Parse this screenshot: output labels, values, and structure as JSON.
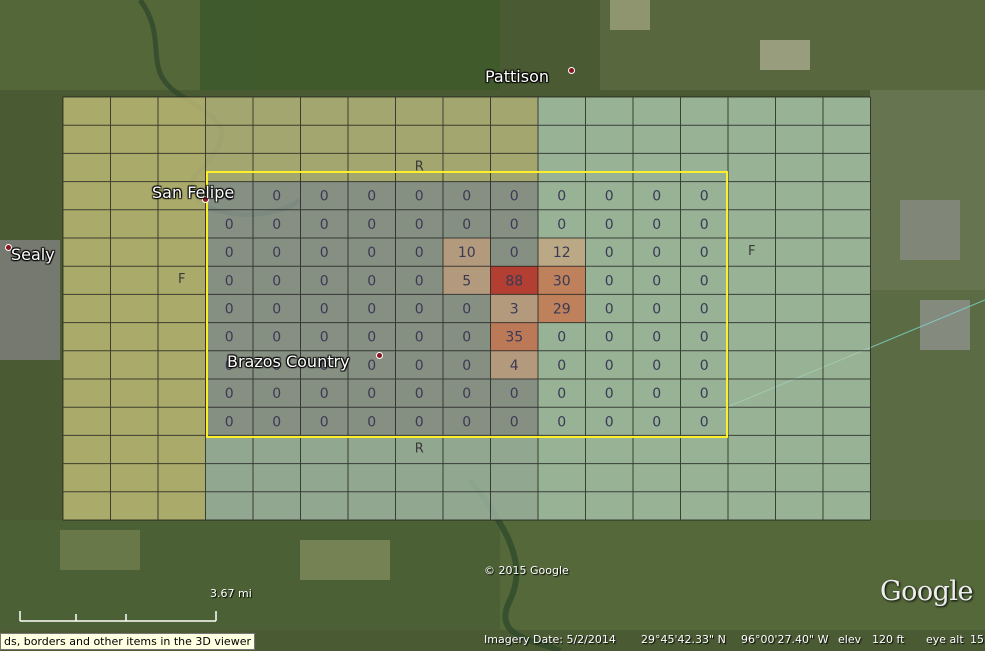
{
  "map": {
    "places": [
      {
        "name": "Pattison"
      },
      {
        "name": "San Felipe"
      },
      {
        "name": "Sealy"
      },
      {
        "name": "Brazos Country"
      }
    ],
    "grid_markers": [
      "R",
      "R",
      "F",
      "F"
    ],
    "cell_values": [
      [
        "0",
        "0",
        "0",
        "0",
        "0",
        "0",
        "0",
        "0",
        "0",
        "0",
        "0"
      ],
      [
        "0",
        "0",
        "0",
        "0",
        "0",
        "0",
        "0",
        "0",
        "0",
        "0",
        "0"
      ],
      [
        "0",
        "0",
        "0",
        "0",
        "0",
        "10",
        "0",
        "12",
        "0",
        "0",
        "0"
      ],
      [
        "0",
        "0",
        "0",
        "0",
        "0",
        "5",
        "88",
        "30",
        "0",
        "0",
        "0"
      ],
      [
        "0",
        "0",
        "0",
        "0",
        "0",
        "0",
        "3",
        "29",
        "0",
        "0",
        "0"
      ],
      [
        "0",
        "0",
        "0",
        "0",
        "0",
        "0",
        "35",
        "0",
        "0",
        "0",
        "0"
      ],
      [
        "0",
        "0",
        "0",
        "0",
        "0",
        "0",
        "4",
        "0",
        "0",
        "0",
        "0"
      ],
      [
        "0",
        "0",
        "0",
        "0",
        "0",
        "0",
        "0",
        "0",
        "0",
        "0",
        "0"
      ],
      [
        "0",
        "0",
        "0",
        "0",
        "0",
        "0",
        "0",
        "0",
        "0",
        "0",
        "0"
      ]
    ],
    "copyright": "© 2015 Google",
    "logo": "Google",
    "scale_label": "3.67 mi"
  },
  "status": {
    "imagery_date": "Imagery Date: 5/2/2014",
    "lat": "29°45'42.33\" N",
    "lon": "96°00'27.40\" W",
    "elev_label": "elev",
    "elev_value": "120 ft",
    "eye_alt": "eye alt",
    "eye_alt_value": "15",
    "tooltip": "ds, borders and other items in the 3D viewer"
  },
  "colors": {
    "yellow_zone": "#c9c05a",
    "green_zone": "#a8d4a8",
    "gray_zone": "#b8bec2",
    "hot": "#b8362a",
    "warm": "#c9734e",
    "mild": "#d9a37a",
    "boundary": "#ffef2a"
  }
}
